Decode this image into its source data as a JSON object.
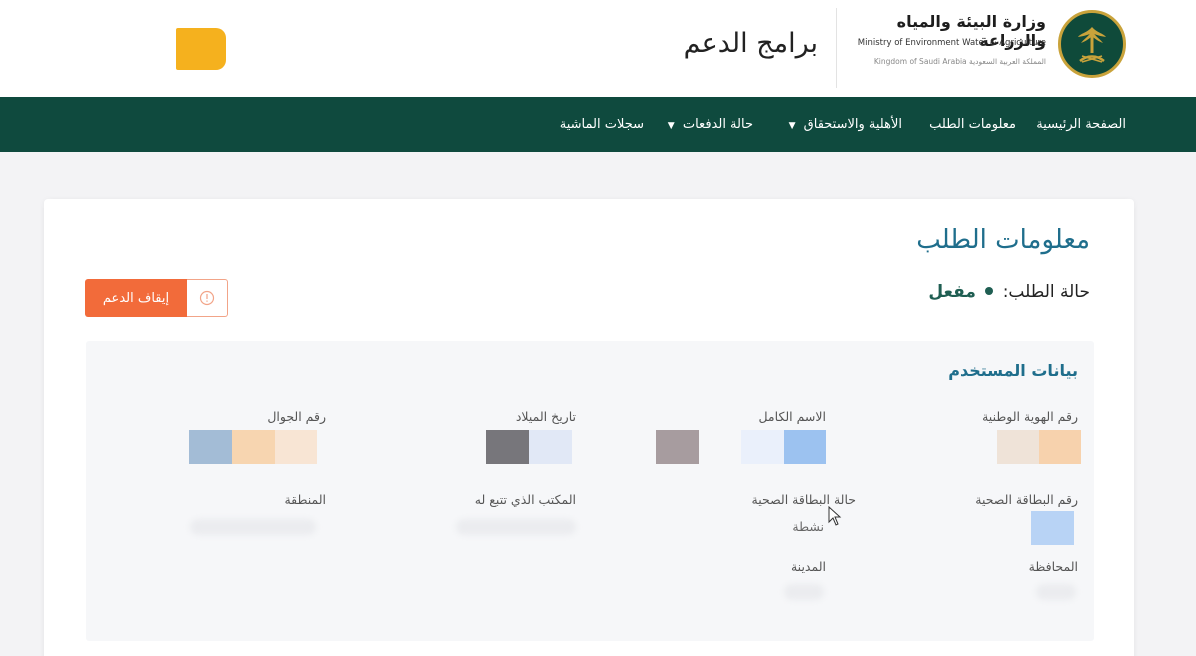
{
  "header": {
    "program_title": "برامج الدعم",
    "ministry_name_ar": "وزارة البيئة والمياه والزراعة",
    "ministry_name_en": "Ministry of Environment Water & Agriculture",
    "ministry_sub": "Kingdom of Saudi Arabia  المملكة العربية السعودية"
  },
  "nav": {
    "items": [
      {
        "label": "الصفحة الرئيسية"
      },
      {
        "label": "معلومات الطلب"
      },
      {
        "label": "الأهلية والاستحقاق",
        "dropdown": true
      },
      {
        "label": "حالة الدفعات",
        "dropdown": true
      },
      {
        "label": "سجلات الماشية"
      }
    ],
    "caret": "▼"
  },
  "page": {
    "title": "معلومات الطلب",
    "status_label": "حالة الطلب:",
    "status_value": "مفعل",
    "stop_button": "إيقاف الدعم",
    "alert_icon": "!"
  },
  "user_data": {
    "title": "بيانات المستخدم",
    "fields": {
      "national_id": "رقم الهوية الوطنية",
      "full_name": "الاسم الكامل",
      "birth_date": "تاريخ الميلاد",
      "mobile": "رقم الجوال",
      "health_card_no": "رقم البطاقة الصحية",
      "health_card_status": "حالة البطاقة الصحية",
      "health_card_status_value": "نشطة",
      "office": "المكتب الذي تتبع له",
      "region": "المنطقة",
      "governorate": "المحافظة",
      "city": "المدينة"
    }
  },
  "colors": {
    "nav_bg": "#0f4a3e",
    "accent_orange": "#f26b3a",
    "title_blue": "#1f6e8c",
    "logo_yellow": "#f5b11e"
  }
}
